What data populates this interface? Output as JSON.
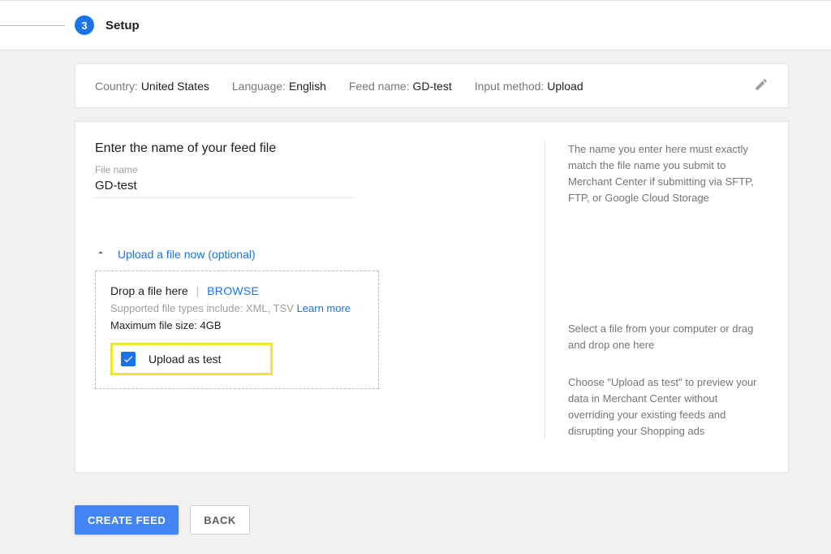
{
  "stepper": {
    "step_number": "3",
    "step_title": "Setup"
  },
  "summary": {
    "country_label": "Country: ",
    "country_value": "United States",
    "language_label": "Language: ",
    "language_value": "English",
    "feed_name_label": "Feed name: ",
    "feed_name_value": "GD-test",
    "input_method_label": "Input method: ",
    "input_method_value": "Upload"
  },
  "main": {
    "section_title": "Enter the name of your feed file",
    "file_name_label": "File name",
    "file_name_value": "GD-test",
    "expander_label": "Upload a file now (optional)",
    "drop_text": "Drop a file here",
    "browse_label": "BROWSE",
    "supported_text": "Supported file types include: XML, TSV ",
    "learn_more": "Learn more",
    "max_size_text": "Maximum file size: 4GB",
    "upload_as_test_label": "Upload as test"
  },
  "help": {
    "para1": "The name you enter here must exactly match the file name you submit to Merchant Center if submitting via SFTP, FTP, or Google Cloud Storage",
    "para2": "Select a file from your computer or drag and drop one here",
    "para3": "Choose \"Upload as test\" to preview your data in Merchant Center without overriding your existing feeds and disrupting your Shopping ads"
  },
  "buttons": {
    "create_feed": "CREATE FEED",
    "back": "BACK"
  }
}
